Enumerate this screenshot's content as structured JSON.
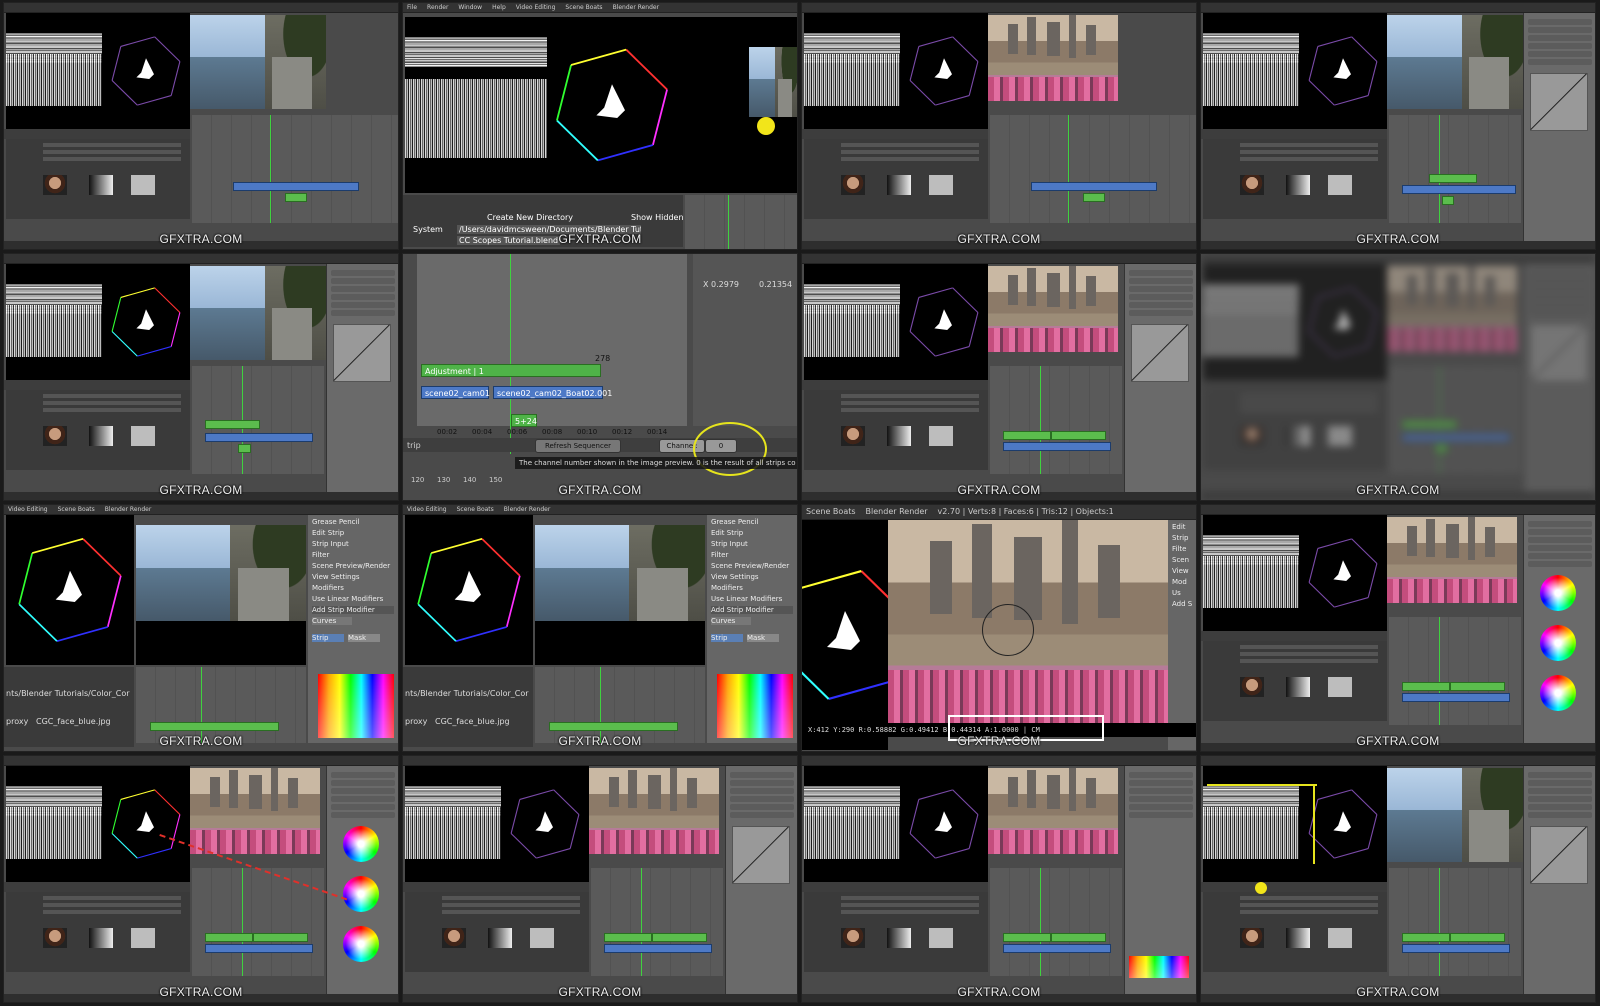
{
  "watermark": "GFXTRA.COM",
  "tiles": [
    {
      "id": 1
    },
    {
      "id": 2
    },
    {
      "id": 3
    },
    {
      "id": 4
    },
    {
      "id": 5
    },
    {
      "id": 6
    },
    {
      "id": 7
    },
    {
      "id": 8
    },
    {
      "id": 9
    },
    {
      "id": 10
    },
    {
      "id": 11
    },
    {
      "id": 12
    },
    {
      "id": 13
    },
    {
      "id": 14
    },
    {
      "id": 15
    },
    {
      "id": 16
    }
  ],
  "tile2": {
    "menu": [
      "File",
      "Render",
      "Window",
      "Help"
    ],
    "layout": "Video Editing",
    "scene": "Scene Boats",
    "engine": "Blender Render",
    "button_new_dir": "Create New Directory",
    "button_show_hidden": "Show Hidden",
    "path": "/Users/davidmcsween/Documents/Blender Tutorials/CC",
    "file": "CC Scopes Tutorial.blend",
    "system_label": "System"
  },
  "tile6": {
    "coord_x": "X 0.2979",
    "coord_y": "0.21354",
    "strip_adjustment": "Adjustment | 1",
    "strip_adjustment_end": "278",
    "strip_cam01": "scene02_cam01",
    "strip_cam02": "scene02_cam02_Boat02.001",
    "frame_label": "5+24",
    "ticks": [
      "00:02",
      "00:04",
      "00:06",
      "00:08",
      "00:10",
      "00:12",
      "00:14"
    ],
    "refresh": "Refresh Sequencer",
    "channel_label": "Channel:",
    "channel_value": "0",
    "strip_label": "trip",
    "tooltip": "The channel number shown in the image preview. 0 is the result of all strips co",
    "bottom_ticks": [
      "120",
      "130",
      "140",
      "150"
    ]
  },
  "tile9": {
    "layout": "Video Editing",
    "scene": "Scene Boats",
    "engine": "Blender Render",
    "sidebar": [
      "Grease Pencil",
      "Edit Strip",
      "Strip Input",
      "Filter",
      "Scene Preview/Render",
      "View Settings",
      "Modifiers"
    ],
    "use_linear": "Use Linear Modifiers",
    "add_mod": "Add Strip Modifier",
    "curves": "Curves",
    "strip_btn": "Strip",
    "mask_btn": "Mask",
    "path": "nts/Blender Tutorials/Color_Correction_Tutorial/CC_M",
    "file": "CGC_face_blue.jpg",
    "proxy": "proxy"
  },
  "tile11": {
    "scene": "Scene Boats",
    "engine": "Blender Render",
    "stats": "v2.70 | Verts:8 | Faces:6 | Tris:12 | Objects:1",
    "sidebar": [
      "Edit",
      "Strip",
      "Filte",
      "Scen",
      "View",
      "Mod"
    ],
    "use": "Us",
    "add": "Add S",
    "pixel_info": "X:412   Y:290   R:0.58882  G:0.49412  B:0.44314  A:1.0000  | CM"
  },
  "colors": {
    "bg": "#1a1a1a",
    "ui": "#4a4a4a",
    "strip_green": "#5bbd4d",
    "strip_blue": "#4d79c6",
    "playhead": "#3fd23f",
    "highlight": "#f2e51a"
  }
}
